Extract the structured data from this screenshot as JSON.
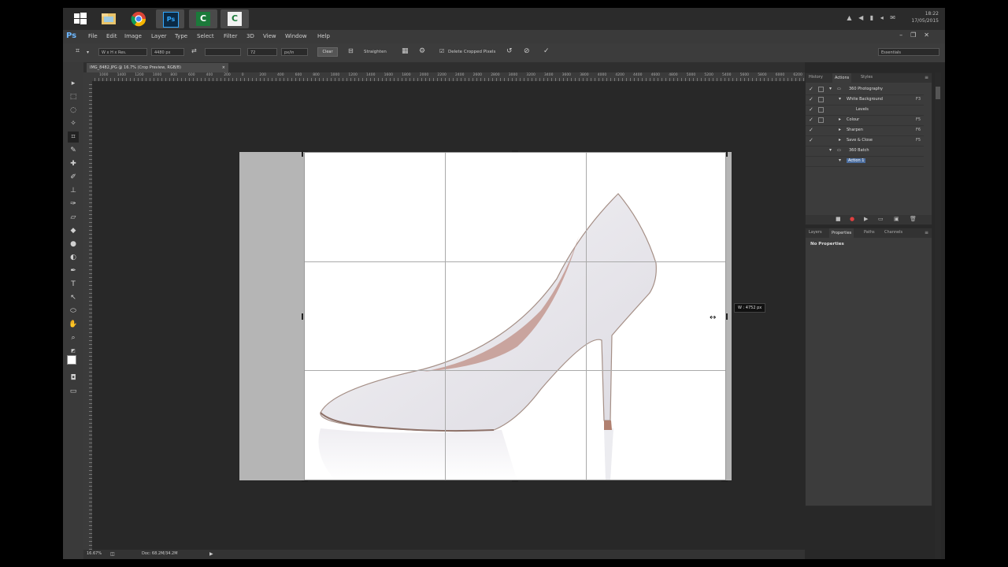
{
  "taskbar": {
    "apps": [
      {
        "name": "windows-start-icon"
      },
      {
        "name": "file-explorer-icon"
      },
      {
        "name": "chrome-icon"
      },
      {
        "name": "photoshop-icon",
        "label": "Ps"
      },
      {
        "name": "camtasia-icon",
        "label": "C"
      },
      {
        "name": "camtasia-recorder-icon",
        "label": "C"
      }
    ],
    "time": "18:22",
    "date": "17/05/2015"
  },
  "menubar": {
    "logo": "Ps",
    "items": [
      "File",
      "Edit",
      "Image",
      "Layer",
      "Type",
      "Select",
      "Filter",
      "3D",
      "View",
      "Window",
      "Help"
    ]
  },
  "options": {
    "ratio": "W x H x Res.",
    "width": "4480 px",
    "height": "",
    "res": "72",
    "units": "px/in",
    "clear": "Clear",
    "straighten": "Straighten",
    "delete_cropped": "Delete Cropped Pixels",
    "workspace": "Essentials"
  },
  "document": {
    "tab": "IMG_8482.JPG @ 16.7% (Crop Preview, RGB/8)",
    "ruler_labels": [
      "1000",
      "1400",
      "1200",
      "1000",
      "800",
      "600",
      "400",
      "200",
      "0",
      "200",
      "400",
      "600",
      "800",
      "1000",
      "1200",
      "1400",
      "1600",
      "1800",
      "2000",
      "2200",
      "2400",
      "2600",
      "2800",
      "3000",
      "3200",
      "3400",
      "3600",
      "3800",
      "4000",
      "4200",
      "4400",
      "4600",
      "4800",
      "5000",
      "5200",
      "5400",
      "5600",
      "5800",
      "6000",
      "6200"
    ],
    "dim_tip": "W : 4752 px",
    "zoom": "16.67%",
    "doc_info": "Doc: 68.2M/34.2M"
  },
  "panels": {
    "top_tabs": [
      "History",
      "Actions",
      "Styles"
    ],
    "active_top_tab": "Actions",
    "actions": [
      {
        "name": "360 Photography",
        "level": 0,
        "type": "set",
        "key": ""
      },
      {
        "name": "White Background",
        "level": 1,
        "type": "action",
        "key": "F3"
      },
      {
        "name": "Levels",
        "level": 2,
        "type": "step",
        "key": ""
      },
      {
        "name": "Colour",
        "level": 1,
        "type": "action",
        "key": "F5"
      },
      {
        "name": "Sharpen",
        "level": 1,
        "type": "action",
        "key": "F6"
      },
      {
        "name": "Save & Close",
        "level": 1,
        "type": "action",
        "key": "F5"
      },
      {
        "name": "360 Batch",
        "level": 0,
        "type": "set",
        "key": ""
      },
      {
        "name": "Action 1",
        "level": 1,
        "type": "action",
        "key": "",
        "selected": true
      }
    ],
    "bottom_tabs": [
      "Layers",
      "Properties",
      "Paths",
      "Channels"
    ],
    "active_bottom_tab": "Properties",
    "properties_text": "No Properties"
  }
}
